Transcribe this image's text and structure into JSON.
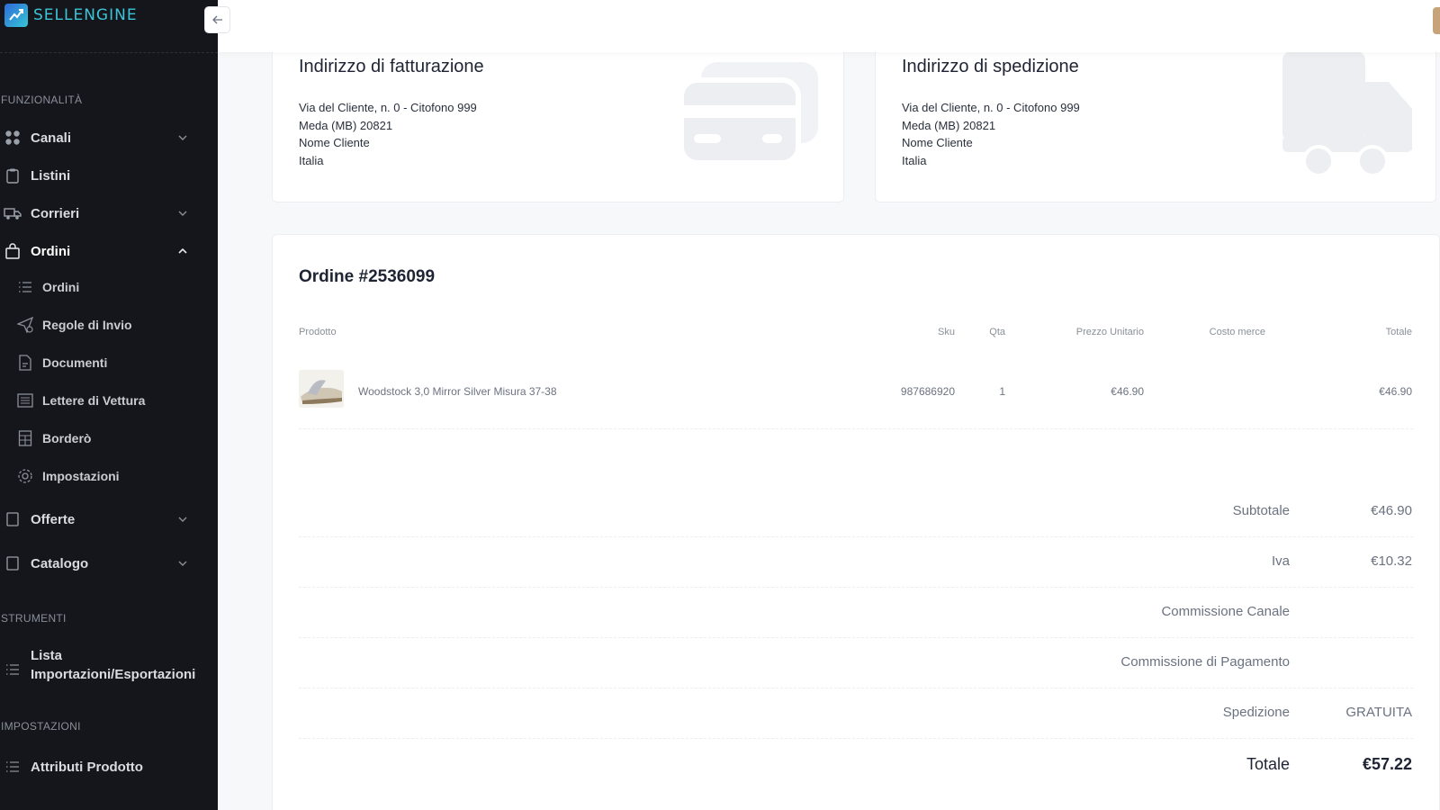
{
  "brand": {
    "name": "SELLENGINE"
  },
  "sidebar": {
    "sections": {
      "features": "FUNZIONALITÀ",
      "tools": "STRUMENTI",
      "settings": "IMPOSTAZIONI"
    },
    "items": {
      "canali": "Canali",
      "listini": "Listini",
      "corrieri": "Corrieri",
      "ordini": "Ordini",
      "offerte": "Offerte",
      "catalogo": "Catalogo",
      "lista_import": "Lista Importazioni/Esportazioni",
      "attributi": "Attributi Prodotto"
    },
    "sub_items": {
      "ordini": "Ordini",
      "regole": "Regole di Invio",
      "documenti": "Documenti",
      "lettere": "Lettere di Vettura",
      "bordero": "Borderò",
      "impostazioni": "Impostazioni"
    }
  },
  "billing": {
    "title": "Indirizzo di fatturazione",
    "lines": [
      "Via del Cliente, n. 0 - Citofono 999",
      "Meda (MB) 20821",
      "Nome Cliente",
      "Italia"
    ]
  },
  "shipping": {
    "title": "Indirizzo di spedizione",
    "lines": [
      "Via del Cliente, n. 0 - Citofono 999",
      "Meda (MB) 20821",
      "Nome Cliente",
      "Italia"
    ]
  },
  "order": {
    "title": "Ordine #2536099",
    "columns": {
      "product": "Prodotto",
      "sku": "Sku",
      "qty": "Qta",
      "unit_price": "Prezzo Unitario",
      "cost": "Costo merce",
      "total": "Totale"
    },
    "rows": [
      {
        "product": "Woodstock 3,0 Mirror Silver Misura 37-38",
        "sku": "987686920",
        "qty": "1",
        "unit_price": "€46.90",
        "cost": "",
        "total": "€46.90"
      }
    ],
    "summary": {
      "subtotal_label": "Subtotale",
      "subtotal_value": "€46.90",
      "iva_label": "Iva",
      "iva_value": "€10.32",
      "channel_fee_label": "Commissione Canale",
      "channel_fee_value": "",
      "payment_fee_label": "Commissione di Pagamento",
      "payment_fee_value": "",
      "shipping_label": "Spedizione",
      "shipping_value": "GRATUITA",
      "total_label": "Totale",
      "total_value": "€57.22"
    }
  }
}
